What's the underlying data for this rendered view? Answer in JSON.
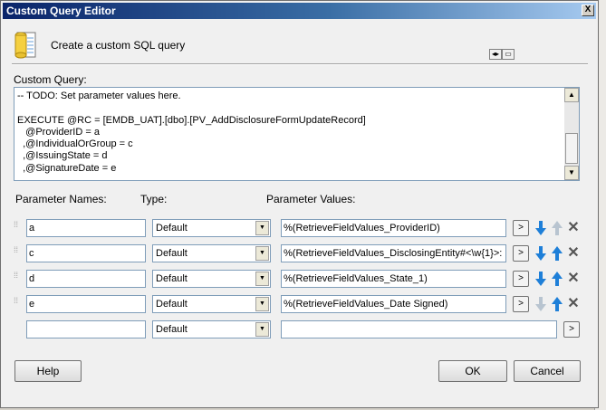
{
  "window": {
    "title": "Custom Query Editor",
    "close_glyph": "X"
  },
  "header": {
    "text": "Create a custom SQL query",
    "icon": "database-icon"
  },
  "query": {
    "label": "Custom Query:",
    "lines": [
      "-- TODO: Set parameter values here.",
      "",
      "EXECUTE @RC = [EMDB_UAT].[dbo].[PV_AddDisclosureFormUpdateRecord]",
      "   @ProviderID = a",
      "  ,@IndividualOrGroup = c",
      "  ,@IssuingState = d",
      "  ,@SignatureDate = e"
    ]
  },
  "columns": {
    "names": "Parameter Names:",
    "type": "Type:",
    "values": "Parameter Values:"
  },
  "params": [
    {
      "name": "a",
      "type": "Default",
      "value": "%(RetrieveFieldValues_ProviderID)",
      "down_enabled": true,
      "up_enabled": false
    },
    {
      "name": "c",
      "type": "Default",
      "value": "%(RetrieveFieldValues_DisclosingEntity#<\\w{1}>:",
      "down_enabled": true,
      "up_enabled": true
    },
    {
      "name": "d",
      "type": "Default",
      "value": "%(RetrieveFieldValues_State_1)",
      "down_enabled": true,
      "up_enabled": true
    },
    {
      "name": "e",
      "type": "Default",
      "value": "%(RetrieveFieldValues_Date Signed)",
      "down_enabled": false,
      "up_enabled": true
    }
  ],
  "new_param": {
    "name": "",
    "type": "Default",
    "value": ""
  },
  "browse_glyph": ">",
  "buttons": {
    "help": "Help",
    "ok": "OK",
    "cancel": "Cancel"
  },
  "colors": {
    "arrow_enabled": "#1e7fd8",
    "arrow_disabled": "#b8c4d0"
  }
}
